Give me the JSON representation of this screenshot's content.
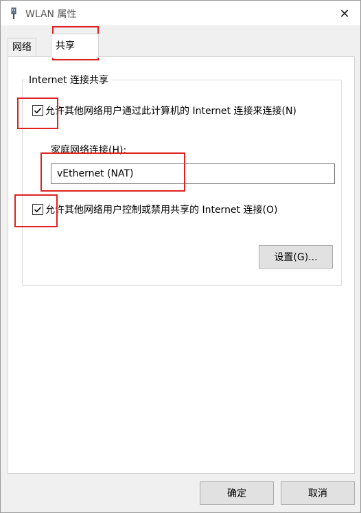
{
  "window": {
    "title": "WLAN 属性"
  },
  "tabs": [
    {
      "label": "网络"
    },
    {
      "label": "共享"
    }
  ],
  "group": {
    "legend": "Internet 连接共享",
    "allow_share_label": "允许其他网络用户通过此计算机的 Internet 连接来连接(N)",
    "allow_share_checked": true,
    "home_network_label": "家庭网络连接(H):",
    "home_network_value": "vEthernet (NAT)",
    "allow_control_label": "允许其他网络用户控制或禁用共享的 Internet 连接(O)",
    "allow_control_checked": true,
    "settings_button": "设置(G)..."
  },
  "footer": {
    "ok_button": "确定",
    "cancel_button": "取消"
  },
  "colors": {
    "annotation": "#e02020",
    "accent": "#0078d7"
  },
  "icons": {
    "app": "network-adapter-icon",
    "close": "close-icon",
    "check": "checkmark-icon"
  }
}
